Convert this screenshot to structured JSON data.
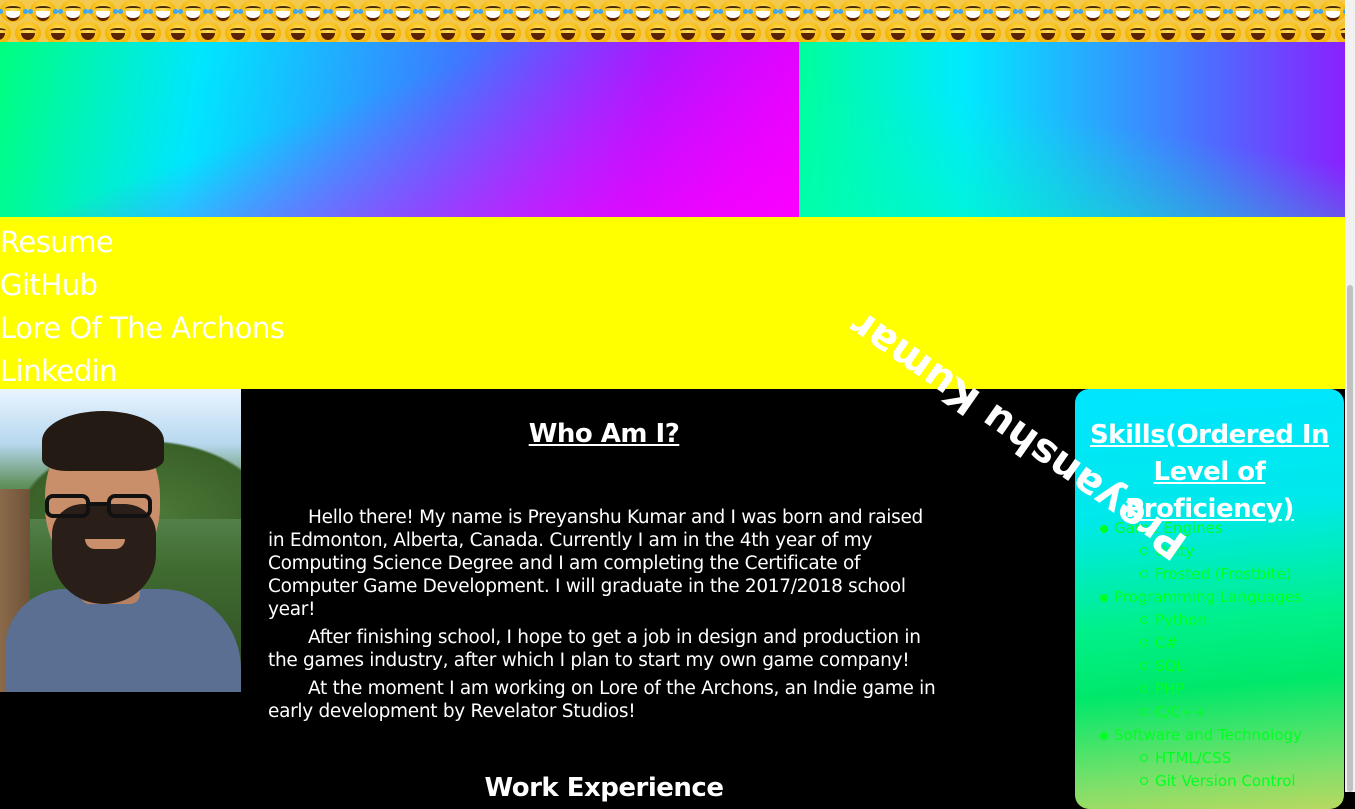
{
  "nav": {
    "links": [
      "Resume",
      "GitHub",
      "Lore Of The Archons",
      "Linkedin"
    ]
  },
  "header": {
    "rotated_name": "Preyanshu Kumar"
  },
  "about": {
    "title": "Who Am I?",
    "paragraphs": [
      "Hello there! My name is Preyanshu Kumar and I was born and raised in Edmonton, Alberta, Canada. Currently I am in the 4th year of my Computing Science Degree and I am completing the Certificate of Computer Game Development. I will graduate in the 2017/2018 school year!",
      "After finishing school, I hope to get a job in design and production in the games industry, after which I plan to start my own game company!",
      "At the moment I am working on Lore of the Archons, an Indie game in early development by Revelator Studios!"
    ],
    "work_title": "Work Experience"
  },
  "skills": {
    "title": "Skills(Ordered In Level of Proficiency)",
    "groups": [
      {
        "name": "Game Engines",
        "items": [
          "Unity",
          "Frosted (Frostbite)"
        ]
      },
      {
        "name": "Programming Languages",
        "items": [
          "Python",
          "C#",
          "SQL",
          "PHP",
          "C/C++"
        ]
      },
      {
        "name": "Software and Technology",
        "items": [
          "HTML/CSS",
          "Git Version Control"
        ]
      }
    ]
  },
  "colors": {
    "nav_bg": "#ffff00",
    "page_bg": "#000000",
    "skill_text": "#00ff22"
  },
  "icons": [
    "laughing-emoji-icon"
  ]
}
